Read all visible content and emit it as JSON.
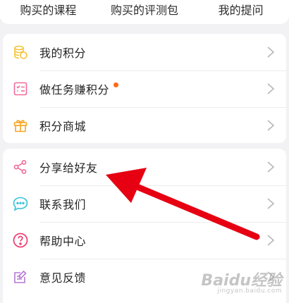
{
  "top_tabs": [
    {
      "label": "购买的课程"
    },
    {
      "label": "购买的评测包"
    },
    {
      "label": "我的提问"
    }
  ],
  "points_menu": [
    {
      "label": "我的积分",
      "icon": "coins-icon",
      "color": "#f3c43a"
    },
    {
      "label": "做任务赚积分",
      "icon": "task-list-icon",
      "color": "#f26a9a",
      "badge": true
    },
    {
      "label": "积分商城",
      "icon": "gift-icon",
      "color": "#f5a623"
    }
  ],
  "service_menu": [
    {
      "label": "分享给好友",
      "icon": "share-icon",
      "color": "#f26a9a"
    },
    {
      "label": "联系我们",
      "icon": "chat-bubble-icon",
      "color": "#35c3d8"
    },
    {
      "label": "帮助中心",
      "icon": "help-icon",
      "color": "#ea3d73"
    },
    {
      "label": "意见反馈",
      "icon": "feedback-edit-icon",
      "color": "#b57ad6"
    }
  ],
  "colors": {
    "badge": "#ff6a14",
    "annotation_arrow": "#e60012"
  },
  "watermark": {
    "main": "Baidu经验",
    "sub": "jingyan.baidu.com"
  }
}
